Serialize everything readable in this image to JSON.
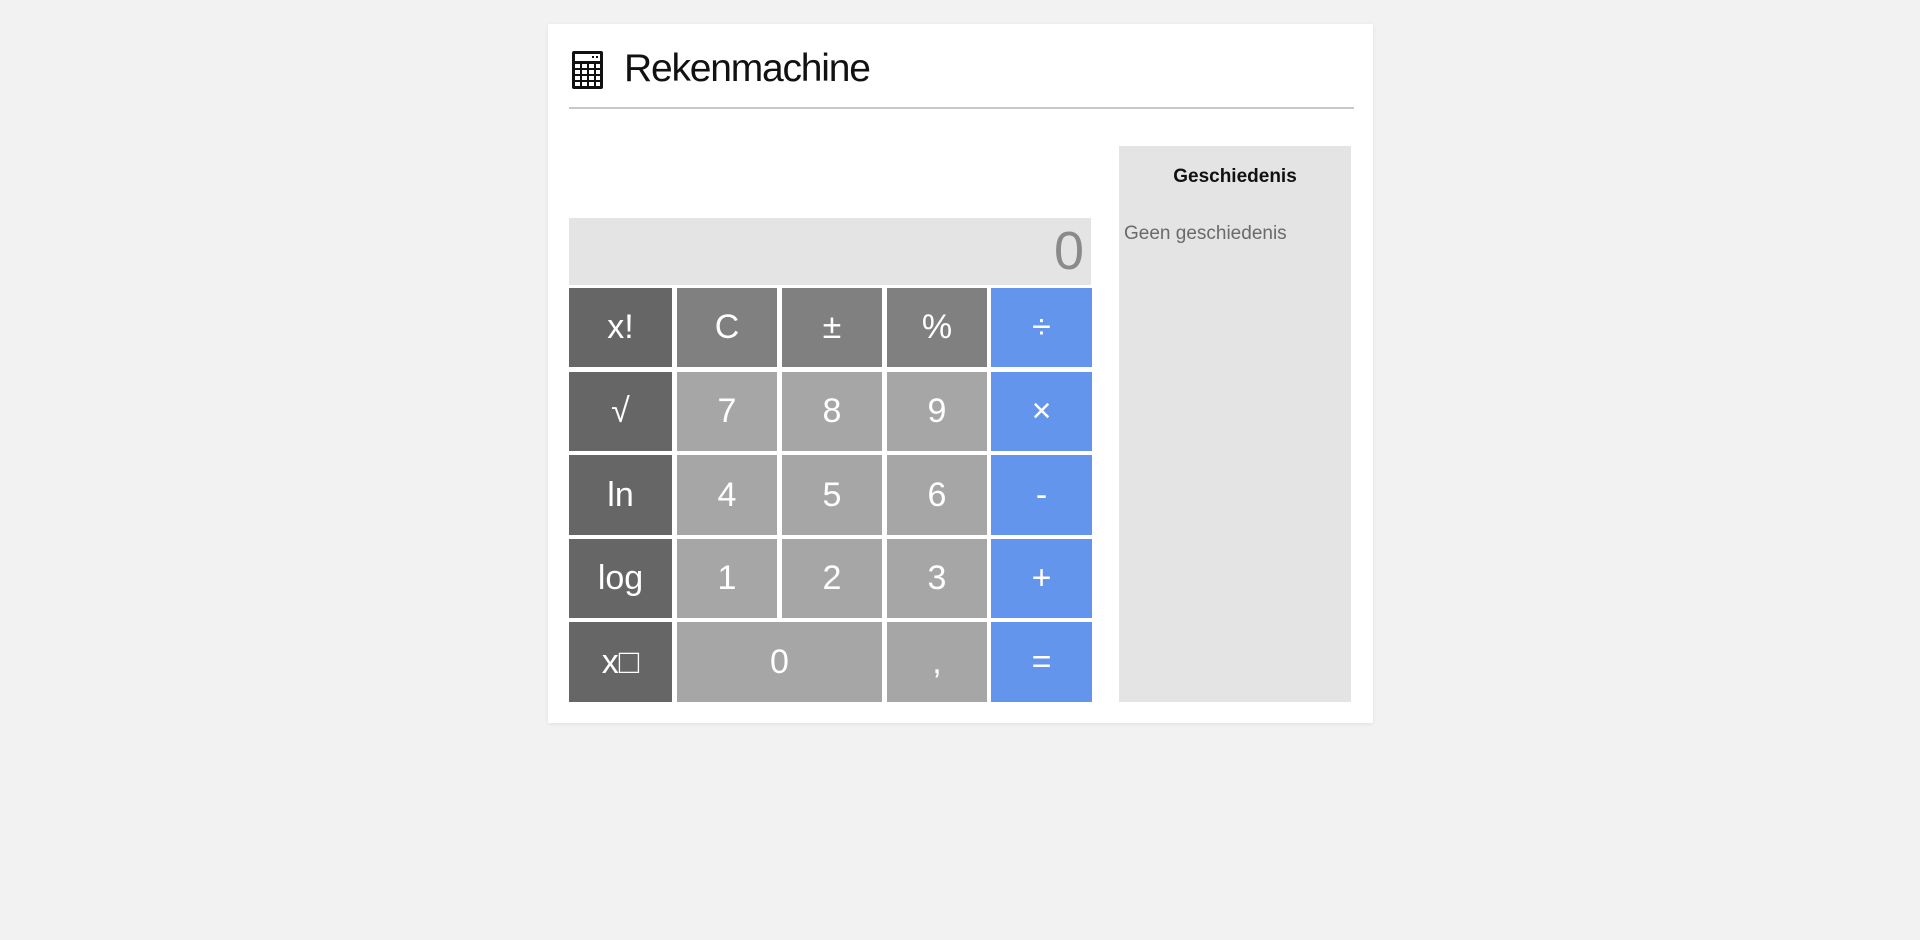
{
  "header": {
    "title": "Rekenmachine",
    "icon": "calculator-icon"
  },
  "display": {
    "value": "0"
  },
  "keys": {
    "factorial": "x!",
    "clear": "C",
    "plus_minus": "±",
    "percent": "%",
    "divide": "÷",
    "sqrt": "√",
    "seven": "7",
    "eight": "8",
    "nine": "9",
    "multiply": "×",
    "ln": "ln",
    "four": "4",
    "five": "5",
    "six": "6",
    "minus": "-",
    "log": "log",
    "one": "1",
    "two": "2",
    "three": "3",
    "plus": "+",
    "power": "x□",
    "zero": "0",
    "decimal": ",",
    "equals": "="
  },
  "history": {
    "title": "Geschiedenis",
    "empty_text": "Geen geschiedenis"
  },
  "colors": {
    "background": "#f2f2f2",
    "card": "#ffffff",
    "display_bg": "#e4e4e4",
    "function_key": "#666666",
    "top_key": "#808080",
    "digit_key": "#a6a6a6",
    "operator_key": "#6495ed"
  }
}
